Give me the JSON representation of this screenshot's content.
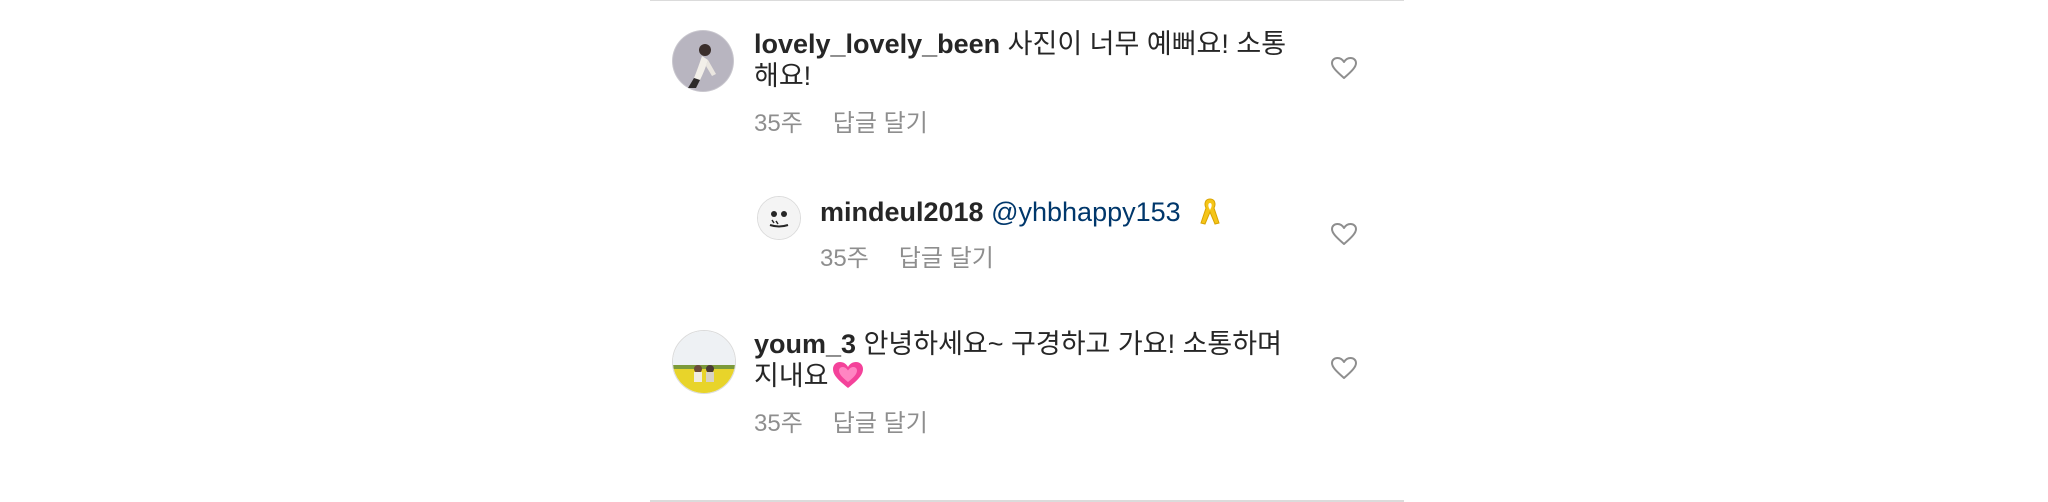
{
  "comments": [
    {
      "username": "lovely_lovely_been",
      "text_line1": "사진이 너무 예뻐요! 소통",
      "text_line2": "해요!",
      "time": "35주",
      "reply_label": "답글 달기"
    },
    {
      "username": "mindeul2018",
      "mention": "@yhbhappy153",
      "emoji": "yellow-ribbon",
      "time": "35주",
      "reply_label": "답글 달기"
    },
    {
      "username": "youm_3",
      "text_line1": "안녕하세요~ 구경하고 가요! 소통하며",
      "text_line2": "지내요",
      "emoji": "growing-heart",
      "time": "35주",
      "reply_label": "답글 달기"
    }
  ],
  "icons": {
    "like": "heart-outline-icon"
  },
  "colors": {
    "text": "#262626",
    "secondary": "#8e8e8e",
    "mention": "#00376b",
    "divider": "#dbdbdb"
  }
}
